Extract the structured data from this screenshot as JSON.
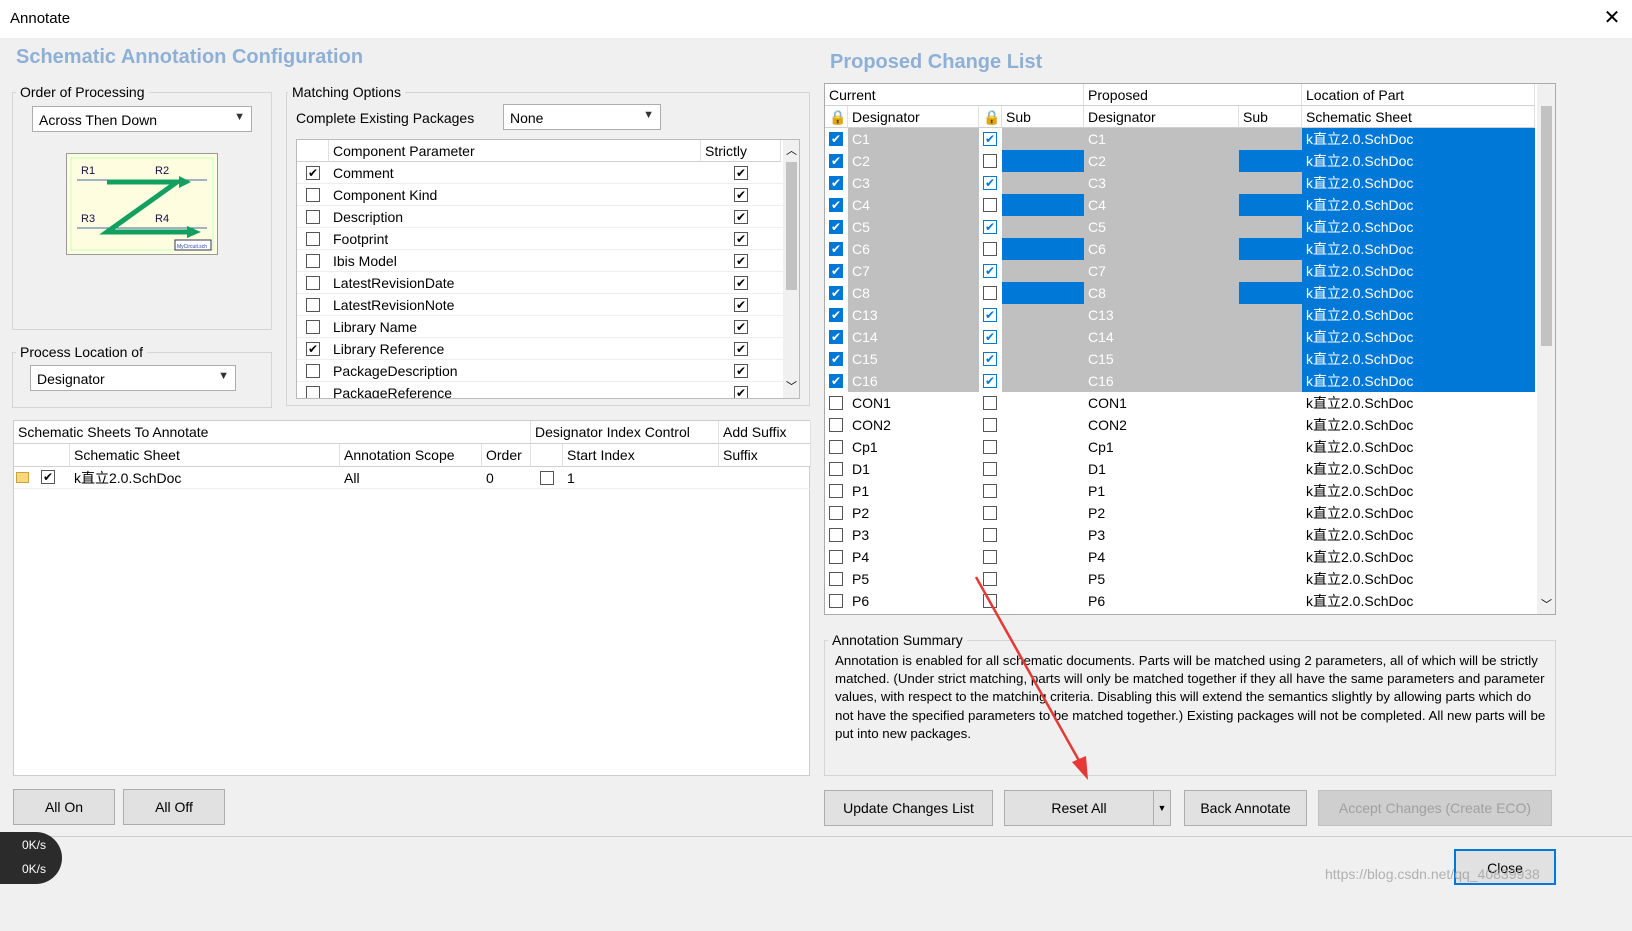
{
  "window": {
    "title": "Annotate",
    "close_glyph": "✕"
  },
  "left": {
    "section_title": "Schematic Annotation Configuration",
    "order_group": "Order of Processing",
    "order_value": "Across Then Down",
    "process_group": "Process Location of",
    "process_value": "Designator",
    "matching_group": "Matching Options",
    "complete_label": "Complete Existing Packages",
    "complete_value": "None",
    "param_headers": [
      "Component Parameter",
      "Strictly"
    ],
    "params": [
      {
        "name": "Comment",
        "on": true,
        "strict": true
      },
      {
        "name": "Component Kind",
        "on": false,
        "strict": true
      },
      {
        "name": "Description",
        "on": false,
        "strict": true
      },
      {
        "name": "Footprint",
        "on": false,
        "strict": true
      },
      {
        "name": "Ibis Model",
        "on": false,
        "strict": true
      },
      {
        "name": "LatestRevisionDate",
        "on": false,
        "strict": true
      },
      {
        "name": "LatestRevisionNote",
        "on": false,
        "strict": true
      },
      {
        "name": "Library Name",
        "on": false,
        "strict": true
      },
      {
        "name": "Library Reference",
        "on": true,
        "strict": true
      },
      {
        "name": "PackageDescription",
        "on": false,
        "strict": true
      },
      {
        "name": "PackageReference",
        "on": false,
        "strict": true
      }
    ],
    "sheets_header": "Schematic Sheets To Annotate",
    "index_header": "Designator Index Control",
    "suffix_header": "Add Suffix",
    "sheet_cols": [
      "Schematic Sheet",
      "Annotation Scope",
      "Order",
      "Start Index",
      "Suffix"
    ],
    "sheet_row": {
      "sheet": "k直立2.0.SchDoc",
      "scope": "All",
      "order": "0",
      "start": "1"
    },
    "all_on": "All On",
    "all_off": "All Off",
    "diagram_labels": [
      "R1",
      "R2",
      "R3",
      "R4",
      "MyCircuit.sch"
    ]
  },
  "right": {
    "section_title": "Proposed Change List",
    "group_headers": [
      "Current",
      "Proposed",
      "Location of Part"
    ],
    "cols": [
      "Designator",
      "Sub",
      "Designator",
      "Sub",
      "Schematic Sheet"
    ],
    "rows": [
      {
        "cur": "C1",
        "sub": true,
        "prop": "C1",
        "sheet": "k直立2.0.SchDoc",
        "sel": true
      },
      {
        "cur": "C2",
        "sub": false,
        "prop": "C2",
        "sheet": "k直立2.0.SchDoc",
        "sel": true
      },
      {
        "cur": "C3",
        "sub": true,
        "prop": "C3",
        "sheet": "k直立2.0.SchDoc",
        "sel": true
      },
      {
        "cur": "C4",
        "sub": false,
        "prop": "C4",
        "sheet": "k直立2.0.SchDoc",
        "sel": true
      },
      {
        "cur": "C5",
        "sub": true,
        "prop": "C5",
        "sheet": "k直立2.0.SchDoc",
        "sel": true
      },
      {
        "cur": "C6",
        "sub": false,
        "prop": "C6",
        "sheet": "k直立2.0.SchDoc",
        "sel": true
      },
      {
        "cur": "C7",
        "sub": true,
        "prop": "C7",
        "sheet": "k直立2.0.SchDoc",
        "sel": true
      },
      {
        "cur": "C8",
        "sub": false,
        "prop": "C8",
        "sheet": "k直立2.0.SchDoc",
        "sel": true
      },
      {
        "cur": "C13",
        "sub": true,
        "prop": "C13",
        "sheet": "k直立2.0.SchDoc",
        "sel": true
      },
      {
        "cur": "C14",
        "sub": true,
        "prop": "C14",
        "sheet": "k直立2.0.SchDoc",
        "sel": true
      },
      {
        "cur": "C15",
        "sub": true,
        "prop": "C15",
        "sheet": "k直立2.0.SchDoc",
        "sel": true
      },
      {
        "cur": "C16",
        "sub": true,
        "prop": "C16",
        "sheet": "k直立2.0.SchDoc",
        "sel": true
      },
      {
        "cur": "CON1",
        "sub": false,
        "prop": "CON1",
        "sheet": "k直立2.0.SchDoc",
        "sel": false
      },
      {
        "cur": "CON2",
        "sub": false,
        "prop": "CON2",
        "sheet": "k直立2.0.SchDoc",
        "sel": false
      },
      {
        "cur": "Cp1",
        "sub": false,
        "prop": "Cp1",
        "sheet": "k直立2.0.SchDoc",
        "sel": false
      },
      {
        "cur": "D1",
        "sub": false,
        "prop": "D1",
        "sheet": "k直立2.0.SchDoc",
        "sel": false
      },
      {
        "cur": "P1",
        "sub": false,
        "prop": "P1",
        "sheet": "k直立2.0.SchDoc",
        "sel": false
      },
      {
        "cur": "P2",
        "sub": false,
        "prop": "P2",
        "sheet": "k直立2.0.SchDoc",
        "sel": false
      },
      {
        "cur": "P3",
        "sub": false,
        "prop": "P3",
        "sheet": "k直立2.0.SchDoc",
        "sel": false
      },
      {
        "cur": "P4",
        "sub": false,
        "prop": "P4",
        "sheet": "k直立2.0.SchDoc",
        "sel": false
      },
      {
        "cur": "P5",
        "sub": false,
        "prop": "P5",
        "sheet": "k直立2.0.SchDoc",
        "sel": false
      },
      {
        "cur": "P6",
        "sub": false,
        "prop": "P6",
        "sheet": "k直立2.0.SchDoc",
        "sel": false
      }
    ],
    "summary_title": "Annotation Summary",
    "summary_text": "Annotation is enabled for all schematic documents. Parts will be matched using 2 parameters, all of which will be strictly matched. (Under strict matching, parts will only be matched together if they all have the same parameters and parameter values, with respect to the matching criteria. Disabling this will extend the semantics slightly by allowing parts which do not have the specified parameters to be matched together.) Existing packages will not be completed. All new parts will be put into new packages.",
    "update_btn": "Update Changes List",
    "reset_btn": "Reset All",
    "back_btn": "Back Annotate",
    "accept_btn": "Accept Changes (Create ECO)"
  },
  "footer": {
    "close": "Close",
    "speed_up": "0K/s",
    "speed_down": "0K/s",
    "watermark": "https://blog.csdn.net/qq_40839938"
  },
  "colors": {
    "selection": "#0078d7",
    "section_title": "#8fb0d6",
    "arrow": "#e53935"
  }
}
